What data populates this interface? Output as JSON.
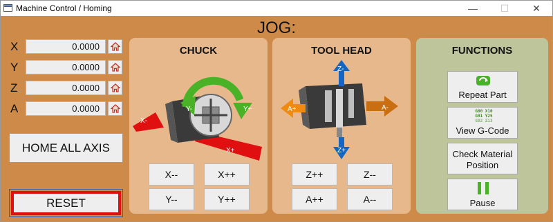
{
  "window": {
    "title": "Machine Control / Homing",
    "icon": "app-window-icon",
    "controls": {
      "minimize": "—",
      "maximize": "☐",
      "close": "✕"
    }
  },
  "jog_title": "JOG:",
  "axes": [
    {
      "label": "X",
      "value": "0.0000",
      "home_icon": "home-icon"
    },
    {
      "label": "Y",
      "value": "0.0000",
      "home_icon": "home-icon"
    },
    {
      "label": "Z",
      "value": "0.0000",
      "home_icon": "home-icon"
    },
    {
      "label": "A",
      "value": "0.0000",
      "home_icon": "home-icon"
    }
  ],
  "home_all_label": "HOME ALL AXIS",
  "reset_label": "RESET",
  "chuck": {
    "title": "CHUCK",
    "arrows": {
      "x_minus": "X-",
      "x_plus": "X+",
      "y_minus": "Y-",
      "y_plus": "Y+"
    },
    "buttons": {
      "x_minus": "X--",
      "x_plus": "X++",
      "y_minus": "Y--",
      "y_plus": "Y++"
    }
  },
  "tool_head": {
    "title": "TOOL HEAD",
    "arrows": {
      "z_minus": "Z-",
      "z_plus": "Z+",
      "a_minus": "A-",
      "a_plus": "A+"
    },
    "buttons": {
      "z_plus": "Z++",
      "z_minus": "Z--",
      "a_plus": "A++",
      "a_minus": "A--"
    }
  },
  "functions": {
    "title": "FUNCTIONS",
    "repeat_part": "Repeat Part",
    "view_gcode": "View G-Code",
    "gcode_icon_lines": [
      "G00 X10",
      "G91 Y25",
      "G02 Z13"
    ],
    "check_material_line1": "Check Material",
    "check_material_line2": "Position",
    "pause": "Pause"
  },
  "colors": {
    "background": "#cd8a48",
    "panel": "#e8b88d",
    "functions_panel": "#bec59a",
    "reset_border": "#e01010",
    "arrow_red": "#e01010",
    "arrow_green": "#49b226",
    "arrow_blue": "#1566c0",
    "arrow_orange": "#f08a10",
    "arrow_brown": "#c96f12"
  }
}
